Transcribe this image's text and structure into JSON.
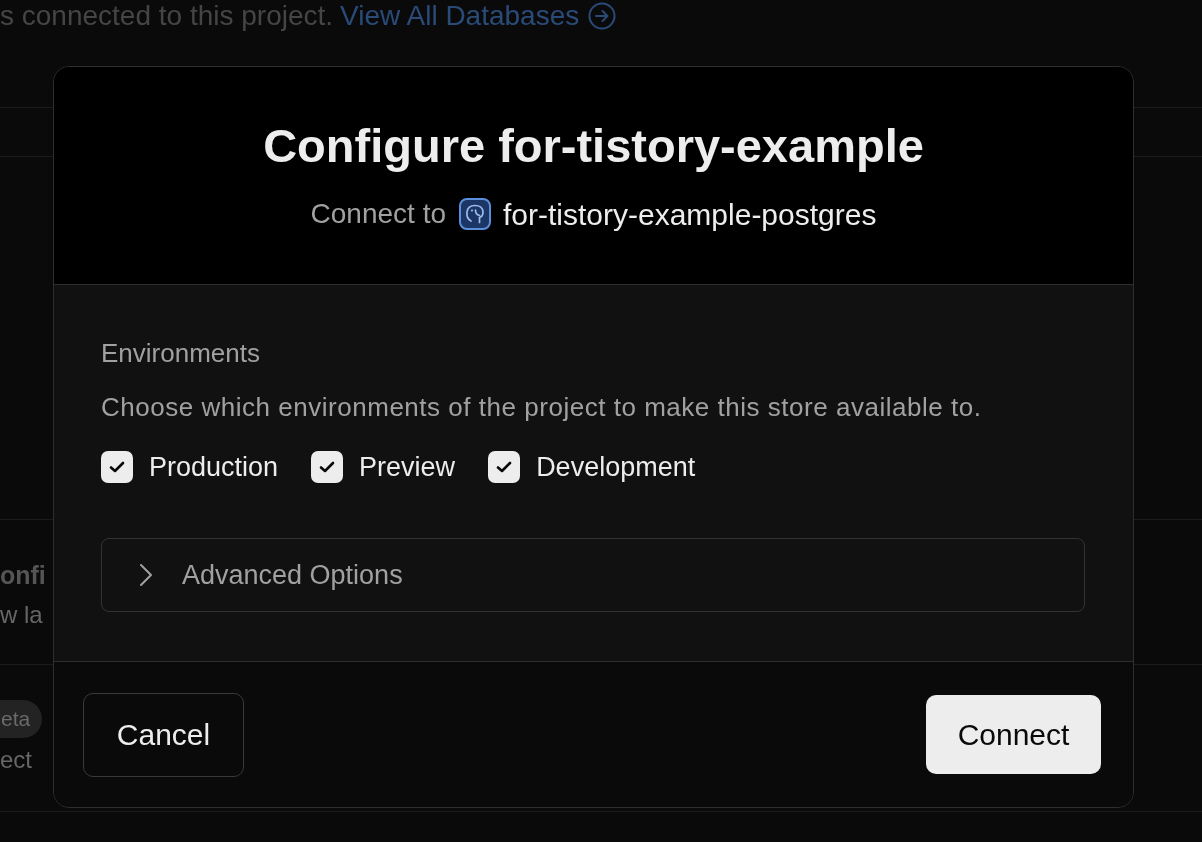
{
  "page": {
    "notice": "s connected to this project.",
    "link": "View All Databases",
    "sections": [
      {
        "title": "onfi",
        "description": "w la"
      },
      {
        "badge": "eta",
        "description": "ect"
      }
    ]
  },
  "dialog": {
    "title": "Configure for-tistory-example",
    "subtitle": {
      "prefix": "Connect to",
      "database": "for-tistory-example-postgres"
    },
    "environments": {
      "label": "Environments",
      "description": "Choose which environments of the project to make this store available to.",
      "options": [
        {
          "label": "Production",
          "checked": true
        },
        {
          "label": "Preview",
          "checked": true
        },
        {
          "label": "Development",
          "checked": true
        }
      ]
    },
    "advanced": {
      "label": "Advanced Options",
      "expanded": false
    },
    "buttons": [
      {
        "label": "Cancel",
        "kind": "secondary"
      },
      {
        "label": "Connect",
        "kind": "primary"
      }
    ]
  }
}
